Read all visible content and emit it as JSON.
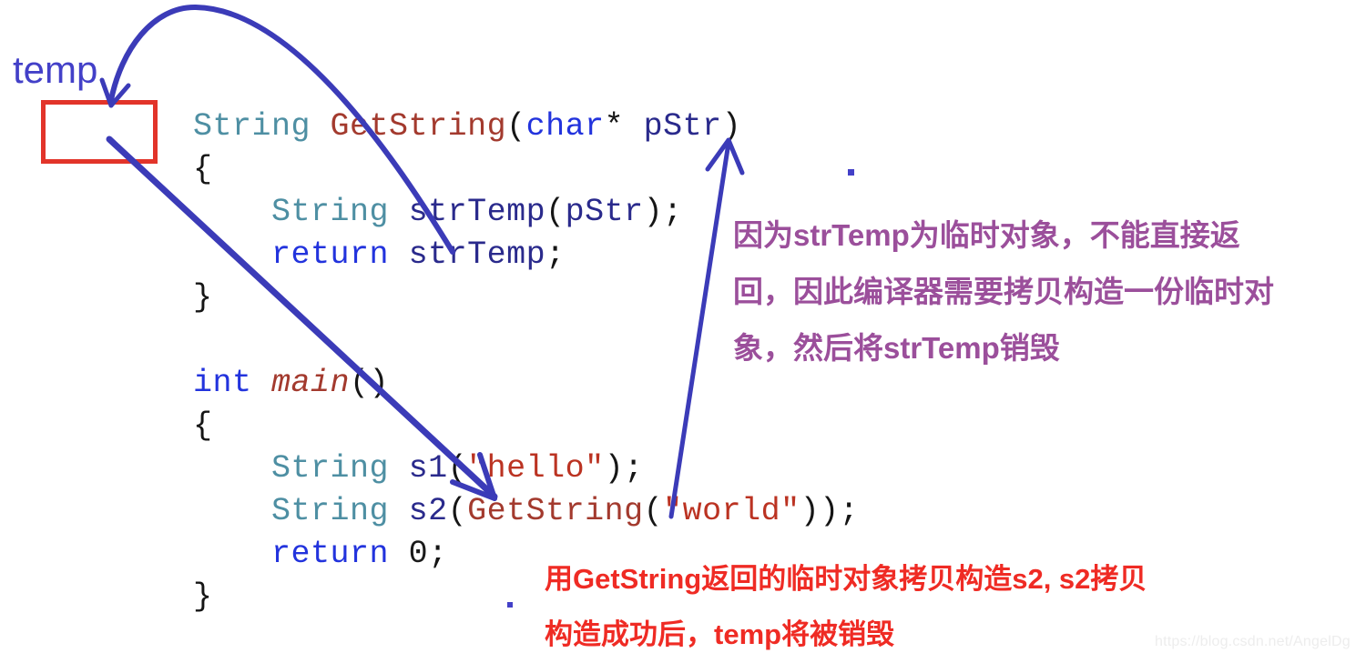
{
  "diagram": {
    "title": "C++ temporary object copy-construction illustration",
    "temp_label": "temp",
    "watermark": "https://blog.csdn.net/AngelDg"
  },
  "colors": {
    "box_border": "#e2342a",
    "arrow": "#3b3bb8",
    "purple_note": "#9b4f9b",
    "red_note": "#ef2b24",
    "code_type": "#4e8fa3",
    "code_func": "#a33a2e",
    "code_keyword": "#2233dd",
    "code_string": "#bb3322",
    "watermark": "#ededed"
  },
  "code": {
    "language": "C++",
    "lines": [
      {
        "id": "l1",
        "tokens": [
          {
            "t": "String",
            "c": "t-type"
          },
          {
            "t": " ",
            "c": "t-punct"
          },
          {
            "t": "GetString",
            "c": "t-func"
          },
          {
            "t": "(",
            "c": "t-punct"
          },
          {
            "t": "char",
            "c": "t-kw"
          },
          {
            "t": "*",
            "c": "t-punct"
          },
          {
            "t": " ",
            "c": "t-punct"
          },
          {
            "t": "pStr",
            "c": "t-ident"
          },
          {
            "t": ")",
            "c": "t-punct"
          }
        ]
      },
      {
        "id": "l2",
        "tokens": [
          {
            "t": "{",
            "c": "t-punct"
          }
        ]
      },
      {
        "id": "l3",
        "tokens": [
          {
            "t": "    ",
            "c": "t-punct"
          },
          {
            "t": "String",
            "c": "t-type"
          },
          {
            "t": " ",
            "c": "t-punct"
          },
          {
            "t": "strTemp",
            "c": "t-ident"
          },
          {
            "t": "(",
            "c": "t-punct"
          },
          {
            "t": "pStr",
            "c": "t-ident"
          },
          {
            "t": ");",
            "c": "t-punct"
          }
        ]
      },
      {
        "id": "l4",
        "tokens": [
          {
            "t": "    ",
            "c": "t-punct"
          },
          {
            "t": "return",
            "c": "t-kw"
          },
          {
            "t": " ",
            "c": "t-punct"
          },
          {
            "t": "strTemp",
            "c": "t-ident"
          },
          {
            "t": ";",
            "c": "t-punct"
          }
        ]
      },
      {
        "id": "l5",
        "tokens": [
          {
            "t": "}",
            "c": "t-punct"
          }
        ]
      },
      {
        "id": "l6",
        "tokens": [
          {
            "t": " ",
            "c": "t-punct"
          }
        ]
      },
      {
        "id": "l7",
        "tokens": [
          {
            "t": "int",
            "c": "t-kw"
          },
          {
            "t": " ",
            "c": "t-punct"
          },
          {
            "t": "main",
            "c": "t-main"
          },
          {
            "t": "()",
            "c": "t-punct"
          }
        ]
      },
      {
        "id": "l8",
        "tokens": [
          {
            "t": "{",
            "c": "t-punct"
          }
        ]
      },
      {
        "id": "l9",
        "tokens": [
          {
            "t": "    ",
            "c": "t-punct"
          },
          {
            "t": "String",
            "c": "t-type"
          },
          {
            "t": " ",
            "c": "t-punct"
          },
          {
            "t": "s1",
            "c": "t-ident"
          },
          {
            "t": "(",
            "c": "t-punct"
          },
          {
            "t": "\"hello\"",
            "c": "t-str"
          },
          {
            "t": ");",
            "c": "t-punct"
          }
        ]
      },
      {
        "id": "l10",
        "tokens": [
          {
            "t": "    ",
            "c": "t-punct"
          },
          {
            "t": "String",
            "c": "t-type"
          },
          {
            "t": " ",
            "c": "t-punct"
          },
          {
            "t": "s2",
            "c": "t-ident"
          },
          {
            "t": "(",
            "c": "t-punct"
          },
          {
            "t": "GetString",
            "c": "t-func"
          },
          {
            "t": "(",
            "c": "t-punct"
          },
          {
            "t": "\"world\"",
            "c": "t-str"
          },
          {
            "t": "));",
            "c": "t-punct"
          }
        ]
      },
      {
        "id": "l11",
        "tokens": [
          {
            "t": "    ",
            "c": "t-punct"
          },
          {
            "t": "return",
            "c": "t-kw"
          },
          {
            "t": " ",
            "c": "t-punct"
          },
          {
            "t": "0",
            "c": "t-num"
          },
          {
            "t": ";",
            "c": "t-punct"
          }
        ]
      },
      {
        "id": "l12",
        "tokens": [
          {
            "t": "}",
            "c": "t-punct"
          }
        ]
      }
    ]
  },
  "annotations": {
    "purple_note": {
      "lines": [
        "因为strTemp为临时对象，不能直接返",
        "回，因此编译器需要拷贝构造一份临时对",
        "象，然后将strTemp销毁"
      ]
    },
    "red_note": {
      "lines": [
        "用GetString返回的临时对象拷贝构造s2, s2拷贝",
        "构造成功后，temp将被销毁"
      ]
    }
  },
  "arrows": [
    {
      "name": "return-to-temp-box",
      "from": "return strTemp;",
      "to": "temp box",
      "style": "curved"
    },
    {
      "name": "temp-box-to-s2",
      "from": "temp box",
      "to": "String s2(...)",
      "style": "straight"
    },
    {
      "name": "world-literal-to-pStr",
      "from": "GetString(\"world\")",
      "to": "pStr parameter",
      "style": "straight"
    }
  ]
}
